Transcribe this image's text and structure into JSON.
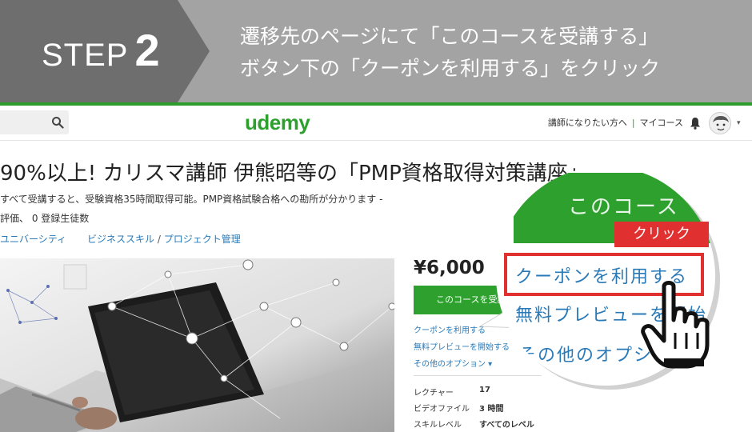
{
  "banner": {
    "step_word": "STEP",
    "step_number": "2",
    "instruction_line1": "遷移先のページにて「このコースを受講する」",
    "instruction_line2": "ボタン下の「クーポンを利用する」をクリック"
  },
  "header": {
    "logo": "udemy",
    "teach_link": "講師になりたい方へ",
    "separator": "|",
    "my_courses": "マイコース",
    "caret": "▾"
  },
  "course": {
    "title": "90%以上! カリスマ講師 伊熊昭等の「PMP資格取得対策講座」",
    "subtitle": "すべて受講すると、受験資格35時間取得可能。PMP資格試験合格への勘所が分かります -",
    "rating": "評価、 0 登録生徒数",
    "category1": "ユニバーシティ",
    "category2": "ビジネススキル",
    "category_slash": " / ",
    "category3": "プロジェクト管理"
  },
  "panel": {
    "price": "¥6,000",
    "enroll_button": "このコースを受講する",
    "coupon_link": "クーポンを利用する",
    "preview_link": "無料プレビューを開始する",
    "options_link": "その他のオプション ▾",
    "meta": [
      {
        "label": "レクチャー",
        "value": "17"
      },
      {
        "label": "ビデオファイル",
        "value": "3 時間"
      },
      {
        "label": "スキルレベル",
        "value": "すべてのレベル"
      }
    ]
  },
  "zoom": {
    "enroll_text": "このコース",
    "coupon_text": "クーポンを利用する",
    "preview_text": "無料プレビューを開始",
    "options_text": "その他のオプション",
    "click_label": "クリック"
  },
  "colors": {
    "brand_green": "#2da02d",
    "link_blue": "#2a7ab8",
    "highlight_red": "#e03030",
    "banner_gray": "#a3a3a3",
    "step_gray": "#6e6e6e"
  }
}
